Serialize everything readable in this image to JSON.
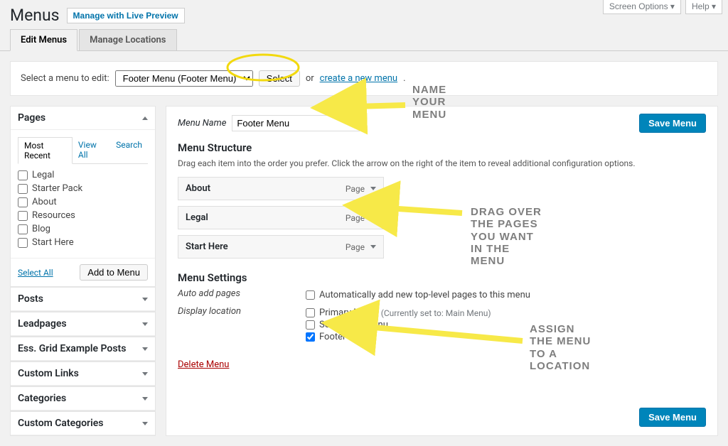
{
  "toolbar": {
    "screen_options": "Screen Options ▾",
    "help": "Help ▾"
  },
  "heading": {
    "title": "Menus",
    "preview": "Manage with Live Preview"
  },
  "tabs": {
    "edit": "Edit Menus",
    "locations": "Manage Locations"
  },
  "selectbar": {
    "label": "Select a menu to edit:",
    "selected": "Footer Menu (Footer Menu)",
    "select_btn": "Select",
    "or": "or ",
    "create_link": "create a new menu",
    "period": "."
  },
  "pages_box": {
    "title": "Pages",
    "inner_tabs": {
      "recent": "Most Recent",
      "view_all": "View All",
      "search": "Search"
    },
    "items": [
      "Legal",
      "Starter Pack",
      "About",
      "Resources",
      "Blog",
      "Start Here"
    ],
    "select_all": "Select All",
    "add_btn": "Add to Menu"
  },
  "accordions": [
    "Posts",
    "Leadpages",
    "Ess. Grid Example Posts",
    "Custom Links",
    "Categories",
    "Custom Categories"
  ],
  "menu_name": {
    "label": "Menu Name",
    "value": "Footer Menu"
  },
  "save": "Save Menu",
  "structure": {
    "title": "Menu Structure",
    "hint": "Drag each item into the order you prefer. Click the arrow on the right of the item to reveal additional configuration options.",
    "items": [
      {
        "title": "About",
        "type": "Page"
      },
      {
        "title": "Legal",
        "type": "Page"
      },
      {
        "title": "Start Here",
        "type": "Page"
      }
    ]
  },
  "settings": {
    "title": "Menu Settings",
    "auto_label": "Auto add pages",
    "auto_option": "Automatically add new top-level pages to this menu",
    "loc_label": "Display location",
    "locations": [
      {
        "name": "Primary Menu",
        "note": "(Currently set to: Main Menu)",
        "checked": false
      },
      {
        "name": "Secondary Menu",
        "note": "",
        "checked": false
      },
      {
        "name": "Footer Menu",
        "note": "",
        "checked": true
      }
    ]
  },
  "delete": "Delete Menu",
  "annotations": {
    "a1": "NAME\nYOUR\nMENU",
    "a2": "DRAG OVER\nTHE PAGES\nYOU WANT\nIN THE\nMENU",
    "a3": "ASSIGN\nTHE MENU\nTO A\nLOCATION"
  }
}
